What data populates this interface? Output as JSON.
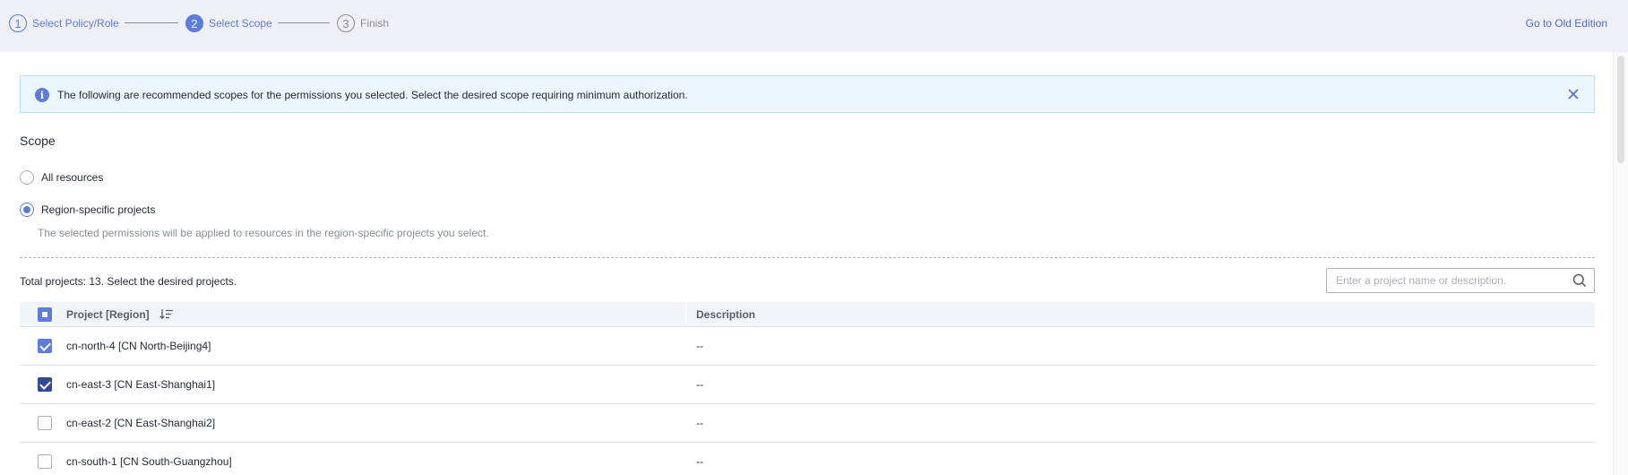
{
  "stepper": {
    "steps": [
      {
        "number": "1",
        "label": "Select Policy/Role",
        "state": "done"
      },
      {
        "number": "2",
        "label": "Select Scope",
        "state": "active"
      },
      {
        "number": "3",
        "label": "Finish",
        "state": "todo"
      }
    ],
    "old_edition_link": "Go to Old Edition"
  },
  "alert": {
    "text": "The following are recommended scopes for the permissions you selected. Select the desired scope requiring minimum authorization.",
    "icon": "info-icon",
    "close_icon": "close-icon"
  },
  "scope": {
    "title": "Scope",
    "options": [
      {
        "label": "All resources",
        "selected": false
      },
      {
        "label": "Region-specific projects",
        "selected": true
      }
    ],
    "hint": "The selected permissions will be applied to resources in the region-specific projects you select."
  },
  "projects": {
    "total_text": "Total projects: 13. Select the desired projects.",
    "search_placeholder": "Enter a project name or description.",
    "columns": {
      "project": "Project [Region]",
      "description": "Description"
    },
    "rows": [
      {
        "project": "cn-north-4 [CN North-Beijing4]",
        "description": "--",
        "checked": true
      },
      {
        "project": "cn-east-3 [CN East-Shanghai1]",
        "description": "--",
        "checked": true
      },
      {
        "project": "cn-east-2 [CN East-Shanghai2]",
        "description": "--",
        "checked": false
      },
      {
        "project": "cn-south-1 [CN South-Guangzhou]",
        "description": "--",
        "checked": false
      }
    ]
  },
  "colors": {
    "accent": "#5e7ce0",
    "link": "#526ecc",
    "alert_bg": "#ebf6ff",
    "header_bg": "#eff0f5"
  }
}
